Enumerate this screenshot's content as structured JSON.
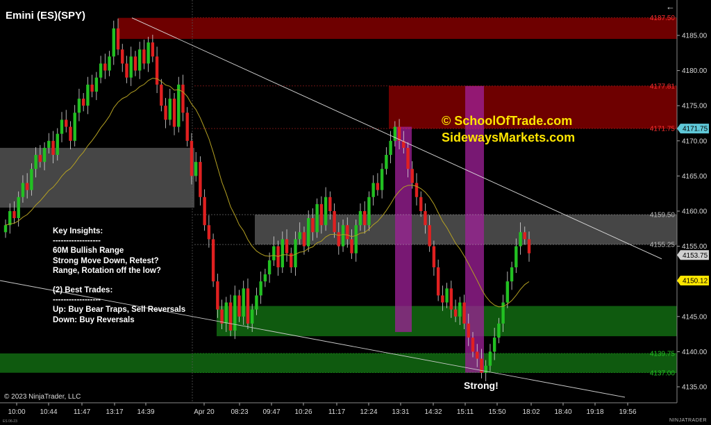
{
  "window": {
    "title": "Emini (ES)(SPY)",
    "back_icon": "back-arrow-icon"
  },
  "insights": {
    "heading": "Key Insights:",
    "divider1": "------------------",
    "line1": "60M Bullish Range",
    "line2": "Strong Move Down, Retest?",
    "line3": "Range, Rotation off the low?",
    "line4": "(2) Best Trades:",
    "divider2": "------------------",
    "line5": "Up: Buy Bear Traps, Sell Reversals",
    "line6": "Down: Buy Reversals"
  },
  "watermark": {
    "line1": "© SchoolOfTrade.com",
    "line2": "SidewaysMarkets.com"
  },
  "annotation_strong": "Strong!",
  "footer": {
    "copyright": "© 2023 NinjaTrader, LLC",
    "brand": "NINJATRADER",
    "instrument_small": "ES 06-23"
  },
  "colors": {
    "background": "#000000",
    "up_candle": "#22c022",
    "down_candle": "#e02020",
    "supply_zone": "#7a0000",
    "range_zone": "#4a4a4a",
    "demand_zone": "#0f5a0f",
    "highlight_zone": "#a0209a",
    "watermark": "#ffe600",
    "ema": "#b4a022"
  },
  "chart_data": {
    "type": "candlestick",
    "y_axis": {
      "min": 4132,
      "max": 4189,
      "ticks": [
        4135.0,
        4140.0,
        4145.0,
        4150.0,
        4155.0,
        4160.0,
        4165.0,
        4170.0,
        4175.0,
        4180.0,
        4185.0
      ]
    },
    "x_axis": {
      "ticks": [
        "10:00",
        "10:44",
        "11:47",
        "13:17",
        "14:39",
        "Apr 20",
        "08:23",
        "09:47",
        "10:26",
        "11:17",
        "12:24",
        "13:31",
        "14:32",
        "15:11",
        "15:50",
        "18:02",
        "18:40",
        "19:18",
        "19:56"
      ]
    },
    "price_labels": [
      {
        "value": 4187.5,
        "text": "4187.50",
        "color": "#ff3030"
      },
      {
        "value": 4177.81,
        "text": "4177.81",
        "color": "#ff3030"
      },
      {
        "value": 4171.75,
        "text": "4171.75",
        "color": "#ff3030"
      },
      {
        "value": 4159.5,
        "text": "4159.50",
        "color": "#bbbbbb"
      },
      {
        "value": 4155.25,
        "text": "4155.25",
        "color": "#bbbbbb"
      },
      {
        "value": 4139.75,
        "text": "4139.75",
        "color": "#22c022"
      },
      {
        "value": 4137.0,
        "text": "4137.00",
        "color": "#22c022"
      }
    ],
    "axis_markers": [
      {
        "value": 4171.75,
        "text": "4171.75",
        "bg": "#5fc8d8",
        "fg": "#000000"
      },
      {
        "value": 4153.75,
        "text": "4153.75",
        "bg": "#d0d0d0",
        "fg": "#000000"
      },
      {
        "value": 4150.12,
        "text": "4150.12",
        "bg": "#ffe600",
        "fg": "#000000"
      }
    ],
    "series": [
      {
        "name": "",
        "close": [
          4158,
          4160,
          4159,
          4162,
          4164,
          4163,
          4166,
          4168,
          4167,
          4169,
          4170,
          4168,
          4171,
          4173,
          4172,
          4170,
          4174,
          4176,
          4175,
          4178,
          4177,
          4179,
          4181,
          4180,
          4182,
          4186,
          4183,
          4181,
          4179,
          4182,
          4180,
          4183,
          4181,
          4184,
          4182,
          4178,
          4175,
          4173,
          4176,
          4172,
          4178,
          4174,
          4170,
          4165,
          4167,
          4162,
          4158,
          4156,
          4150,
          4146,
          4144,
          4147,
          4143,
          4148,
          4145,
          4149,
          4144,
          4146,
          4148,
          4150,
          4151,
          4153,
          4155,
          4152,
          4156,
          4154,
          4152,
          4156,
          4157,
          4155,
          4159,
          4157,
          4161,
          4158,
          4162,
          4160,
          4157,
          4155,
          4158,
          4156,
          4154,
          4158,
          4160,
          4158,
          4162,
          4164,
          4163,
          4166,
          4168,
          4170,
          4172,
          4170,
          4169,
          4166,
          4164,
          4162,
          4160,
          4158,
          4155,
          4152,
          4148,
          4147,
          4149,
          4146,
          4145,
          4147,
          4144,
          4142,
          4140,
          4139,
          4137,
          4138,
          4140,
          4142,
          4144,
          4147,
          4150,
          4152,
          4155,
          4157,
          4156,
          4154
        ]
      }
    ]
  }
}
